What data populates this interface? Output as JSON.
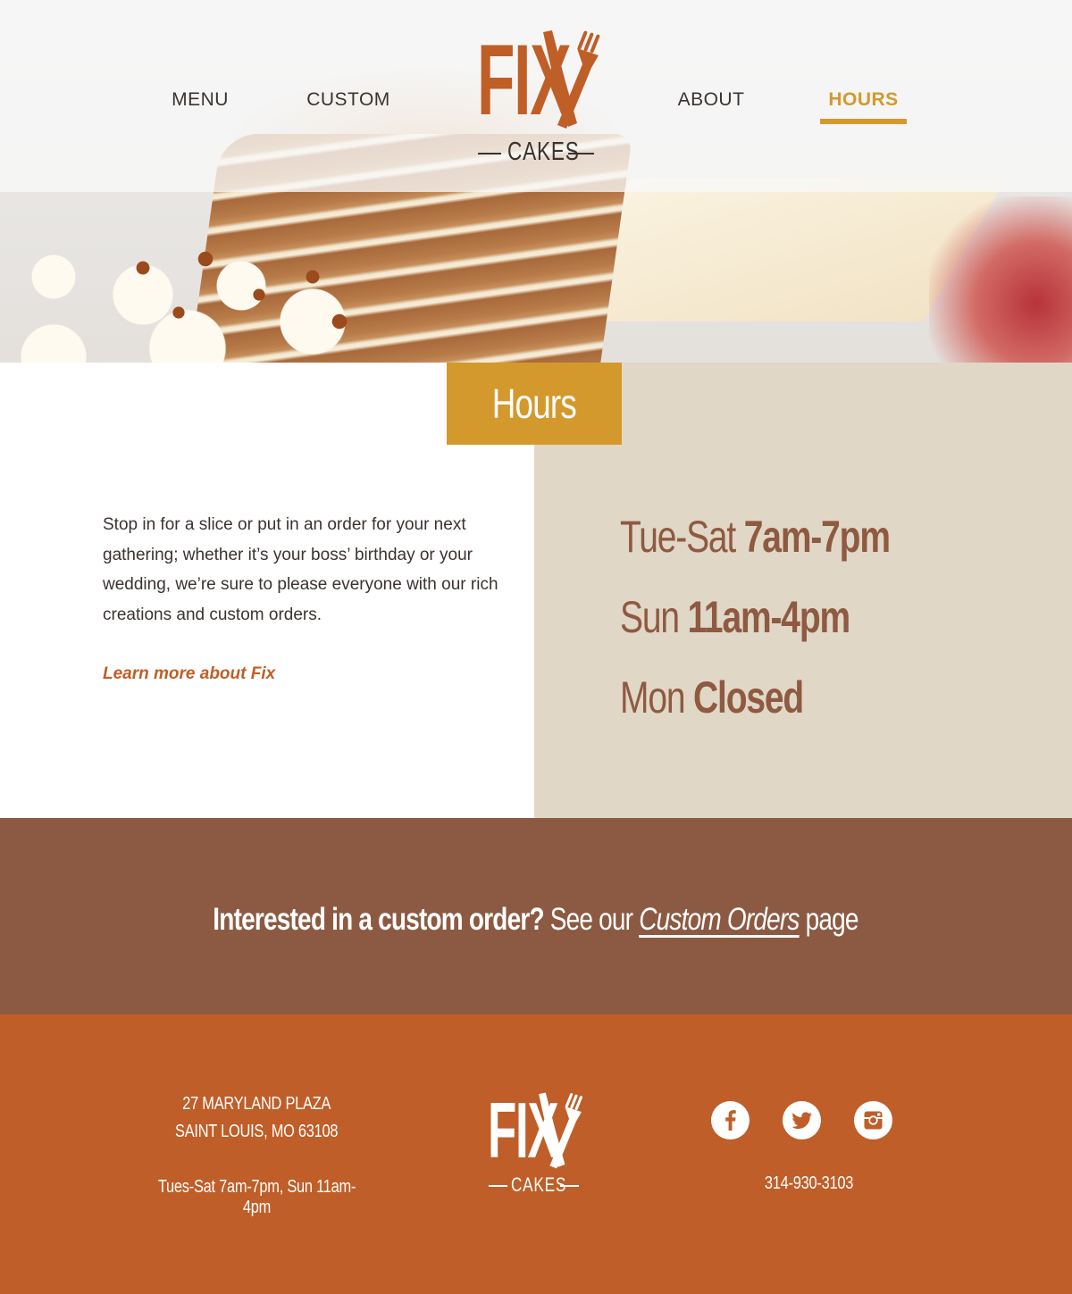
{
  "nav": {
    "menu": "MENU",
    "custom": "CUSTOM",
    "about": "ABOUT",
    "hours": "HOURS",
    "active": "HOURS"
  },
  "logo": {
    "word": "FIX",
    "sub": "CAKES"
  },
  "page": {
    "title": "Hours",
    "intro": "Stop in for a slice or put in an order for your next gathering; whether it’s your boss’ birthday or your wedding, we’re sure to please everyone with our rich creations and custom orders.",
    "learn_more": "Learn more about Fix"
  },
  "hours": [
    {
      "day": "Tue-Sat",
      "time": "7am-7pm"
    },
    {
      "day": "Sun",
      "time": "11am-4pm"
    },
    {
      "day": "Mon",
      "time": "Closed"
    }
  ],
  "cta": {
    "lead": "Interested in a custom order?",
    "pre_link": "See our",
    "link": "Custom Orders",
    "post_link": "page"
  },
  "footer": {
    "address_line1": "27 MARYLAND PLAZA",
    "address_line2": "SAINT LOUIS, MO 63108",
    "hours": "Tues-Sat 7am-7pm, Sun 11am-4pm",
    "phone": "314-930-3103",
    "social": [
      "facebook-icon",
      "twitter-icon",
      "instagram-icon"
    ]
  },
  "colors": {
    "accent_gold": "#d4992c",
    "brand_orange": "#c05e27",
    "brown": "#8c5a42",
    "cream": "#e1d7c6",
    "footer": "#bf5e28"
  }
}
